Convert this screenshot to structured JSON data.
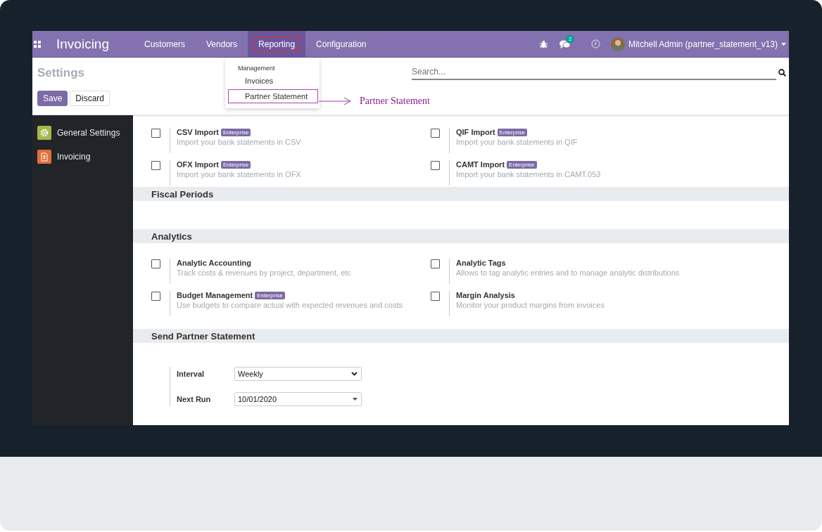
{
  "navbar": {
    "app_title": "Invoicing",
    "menu": [
      {
        "label": "Customers",
        "selected": false,
        "outlined": false
      },
      {
        "label": "Vendors",
        "selected": false,
        "outlined": false
      },
      {
        "label": "Reporting",
        "selected": true,
        "outlined": true
      },
      {
        "label": "Configuration",
        "selected": false,
        "outlined": false
      }
    ],
    "message_count": "2",
    "user": "Mitchell Admin (partner_statement_v13)"
  },
  "dropdown": {
    "section": "Management",
    "items": [
      {
        "label": "Invoices",
        "outlined": false
      },
      {
        "label": "Partner Statement",
        "outlined": true
      }
    ]
  },
  "annotation": "Partner Statement",
  "control_panel": {
    "breadcrumb": "Settings",
    "buttons": [
      {
        "label": "Save",
        "kind": "primary"
      },
      {
        "label": "Discard",
        "kind": "secondary"
      }
    ],
    "search": {
      "placeholder": "Search..."
    }
  },
  "sidebar": {
    "items": [
      {
        "label": "General Settings",
        "color": "#a4b74a"
      },
      {
        "label": "Invoicing",
        "color": "#e0703a"
      }
    ]
  },
  "sections": [
    {
      "settings": [
        {
          "label": "CSV Import",
          "badge": "Enterprise",
          "description": "Import your bank statements in CSV",
          "checked": false
        },
        {
          "label": "QIF Import",
          "badge": "Enterprise",
          "description": "Import your bank statements in QIF",
          "checked": false
        },
        {
          "label": "OFX Import",
          "badge": "Enterprise",
          "description": "Import your bank statements in OFX",
          "checked": false
        },
        {
          "label": "CAMT Import",
          "badge": "Enterprise",
          "description": "Import your bank statements in CAMT.053",
          "checked": false
        }
      ]
    },
    {
      "title": "Fiscal Periods"
    },
    {
      "title": "Analytics",
      "settings": [
        {
          "label": "Analytic Accounting",
          "description": "Track costs & revenues by project, department, etc",
          "checked": false
        },
        {
          "label": "Analytic Tags",
          "description": "Allows to tag analytic entries and to manage analytic distributions",
          "checked": false
        },
        {
          "label": "Budget Management",
          "badge": "Enterprise",
          "description": "Use budgets to compare actual with expected revenues and costs",
          "checked": false
        },
        {
          "label": "Margin Analysis",
          "description": "Monitor your product margins from invoices",
          "checked": false
        }
      ]
    },
    {
      "title": "Send Partner Statement",
      "fields": [
        {
          "label": "Interval",
          "kind": "select",
          "value": "Weekly"
        },
        {
          "label": "Next Run",
          "kind": "date",
          "value": "10/01/2020"
        }
      ]
    }
  ]
}
